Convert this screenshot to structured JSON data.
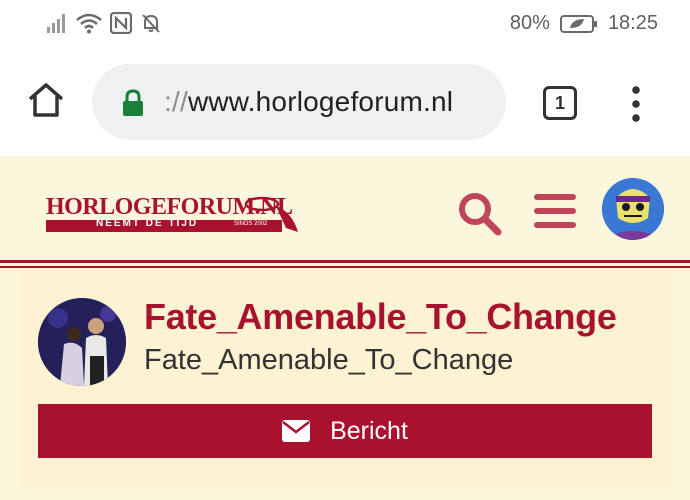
{
  "status_bar": {
    "battery": "80%",
    "time": "18:25",
    "icons": [
      "signal-icon",
      "wifi-icon",
      "nfc-icon",
      "notifications-off-icon",
      "battery-saver-icon"
    ]
  },
  "browser": {
    "url_scheme": "://",
    "url_host": "www.horlogeforum.nl",
    "tab_count": "1"
  },
  "site": {
    "logo_name": "HORLOGEFORUM.NL",
    "logo_tagline": "NEEMT DE TIJD",
    "logo_since": "SINDS 2002",
    "brand_color": "#a8122e"
  },
  "profile": {
    "username": "Fate_Amenable_To_Change",
    "display_name": "Fate_Amenable_To_Change",
    "message_button": "Bericht"
  }
}
